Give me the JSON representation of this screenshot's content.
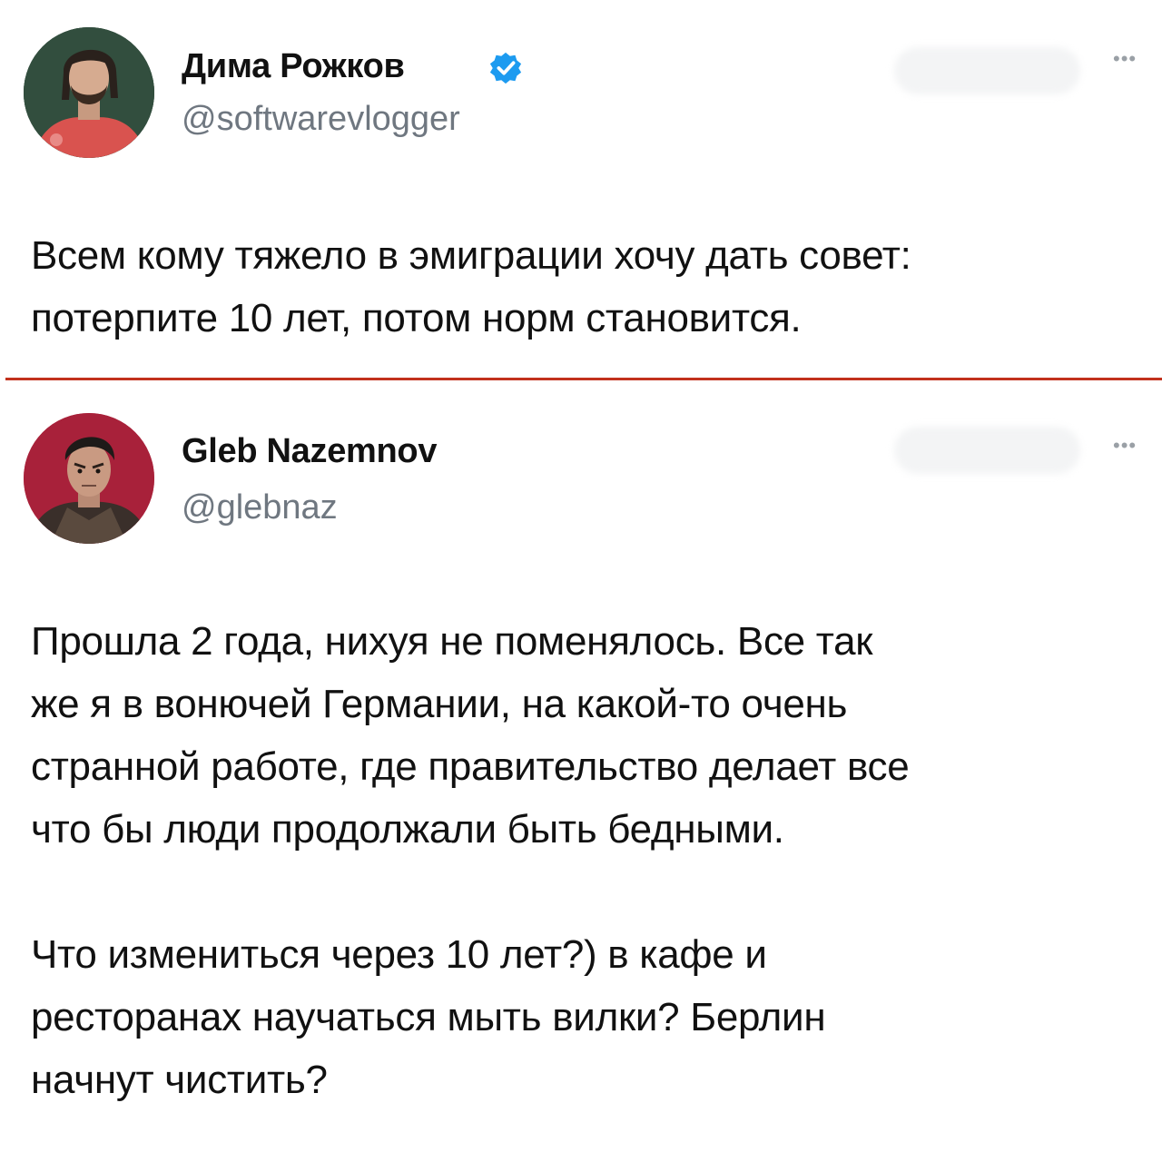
{
  "tweets": [
    {
      "author_name": "Дима Рожков",
      "verified": true,
      "handle": "@softwarevlogger",
      "more_icon": "more-horizontal-icon",
      "lines": [
        "Всем кому тяжело в эмиграции хочу дать совет:",
        "потерпите 10 лет, потом норм становится."
      ]
    },
    {
      "author_name": "Gleb Nazemnov",
      "verified": false,
      "handle": "@glebnaz",
      "more_icon": "more-horizontal-icon",
      "paragraphs": [
        [
          "Прошла 2 года, нихуя не поменялось. Все так",
          "же я в вонючей Германии, на какой-то очень",
          "странной работе, где правительство делает все",
          "что бы люди продолжали быть бедными."
        ],
        [
          "Что измениться через 10 лет?) в кафе и",
          "ресторанах научаться мыть вилки? Берлин",
          "начнут чистить?"
        ]
      ]
    }
  ],
  "colors": {
    "divider": "#c2321d",
    "verified_badge": "#1d9bf0",
    "handle_text": "#6f7780"
  }
}
